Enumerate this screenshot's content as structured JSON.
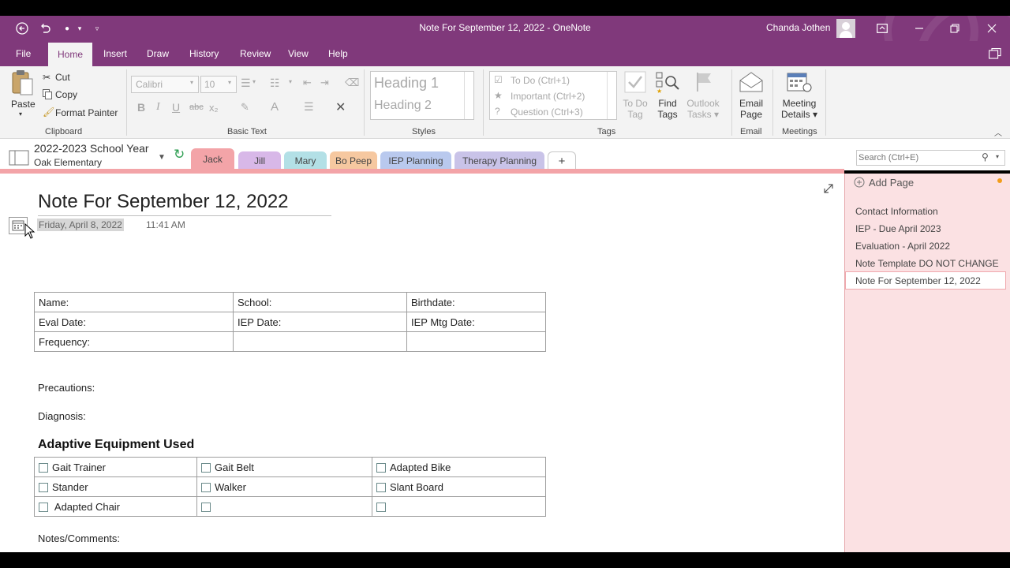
{
  "window": {
    "title": "Note For September 12, 2022  -  OneNote",
    "user": "Chanda Jothen"
  },
  "menu": {
    "tabs": [
      "File",
      "Home",
      "Insert",
      "Draw",
      "History",
      "Review",
      "View",
      "Help"
    ]
  },
  "ribbon": {
    "clipboard": {
      "paste": "Paste",
      "cut": "Cut",
      "copy": "Copy",
      "format_painter": "Format Painter",
      "label": "Clipboard"
    },
    "basic_text": {
      "font_name": "Calibri",
      "font_size": "10",
      "label": "Basic Text"
    },
    "styles": {
      "heading1": "Heading 1",
      "heading2": "Heading 2",
      "label": "Styles"
    },
    "tags": {
      "todo": "To Do (Ctrl+1)",
      "important": "Important (Ctrl+2)",
      "question": "Question (Ctrl+3)",
      "todo_tag": [
        "To Do",
        "Tag"
      ],
      "find_tags": [
        "Find",
        "Tags"
      ],
      "outlook_tasks": [
        "Outlook",
        "Tasks"
      ],
      "label": "Tags"
    },
    "email": {
      "button": [
        "Email",
        "Page"
      ],
      "label": "Email"
    },
    "meetings": {
      "button": [
        "Meeting",
        "Details"
      ],
      "label": "Meetings"
    }
  },
  "notebook": {
    "name": "2022-2023 School Year",
    "section_group": "Oak Elementary",
    "sections": [
      {
        "label": "Jack",
        "color": "#f3a4a8"
      },
      {
        "label": "Jill",
        "color": "#d8b8e8"
      },
      {
        "label": "Mary",
        "color": "#b3e0e6"
      },
      {
        "label": "Bo Peep",
        "color": "#f6c8a0"
      },
      {
        "label": "IEP Planning",
        "color": "#b9c9ee"
      },
      {
        "label": "Therapy Planning",
        "color": "#c9c3e8"
      }
    ],
    "add_section": "+"
  },
  "search": {
    "placeholder": "Search (Ctrl+E)"
  },
  "page": {
    "title": "Note For September 12, 2022",
    "date": "Friday, April 8, 2022",
    "time": "11:41 AM",
    "info_table": [
      [
        "Name:",
        "School:",
        "Birthdate:"
      ],
      [
        "Eval Date:",
        "IEP Date:",
        "IEP Mtg Date:"
      ],
      [
        "Frequency:",
        "",
        ""
      ]
    ],
    "precautions": "Precautions:",
    "diagnosis": "Diagnosis:",
    "equipment_heading": "Adaptive Equipment Used",
    "equipment_table": [
      [
        "Gait Trainer",
        "Gait Belt",
        "Adapted Bike"
      ],
      [
        "Stander",
        "Walker",
        "Slant Board"
      ],
      [
        "Adapted Chair",
        "",
        ""
      ]
    ],
    "notes": "Notes/Comments:"
  },
  "pages_panel": {
    "add_page": "Add Page",
    "items": [
      "Contact Information",
      "IEP - Due April 2023",
      "Evaluation - April 2022",
      "Note Template DO NOT CHANGE",
      "Note For September 12, 2022"
    ]
  }
}
